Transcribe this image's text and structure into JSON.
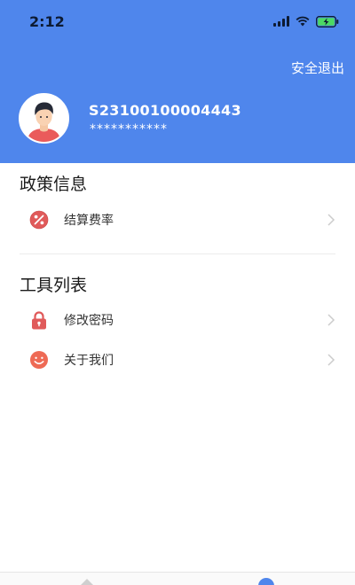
{
  "status_bar": {
    "time": "2:12"
  },
  "header": {
    "logout_label": "安全退出",
    "account_id": "S23100100004443",
    "account_mask": "***********"
  },
  "sections": [
    {
      "title": "政策信息",
      "items": [
        {
          "label": "结算费率",
          "icon": "percent-icon"
        }
      ]
    },
    {
      "title": "工具列表",
      "items": [
        {
          "label": "修改密码",
          "icon": "lock-icon"
        },
        {
          "label": "关于我们",
          "icon": "smiley-icon"
        }
      ]
    }
  ],
  "colors": {
    "header_bg": "#4f86ec",
    "icon_red": "#e05a5a",
    "battery_green": "#4cd964"
  }
}
